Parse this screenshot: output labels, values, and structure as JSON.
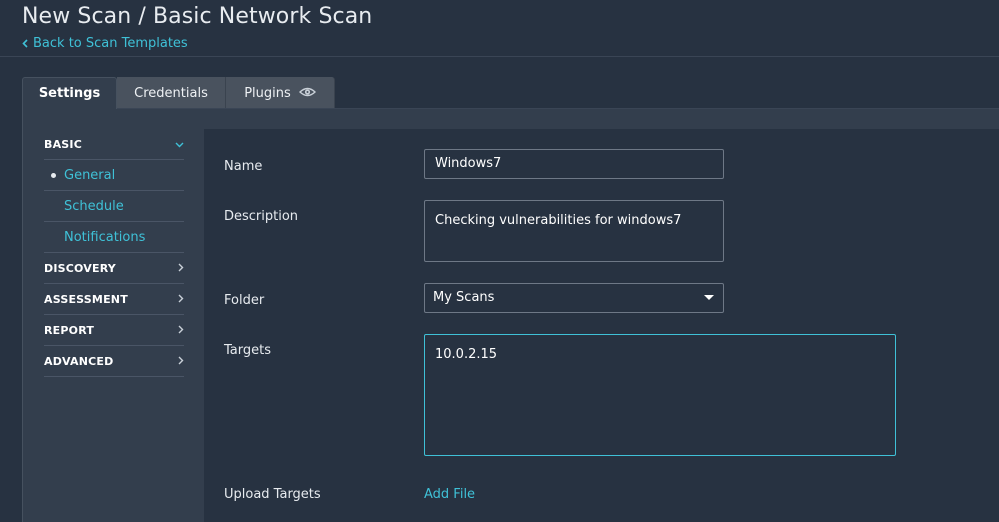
{
  "header": {
    "title": "New Scan / Basic Network Scan",
    "back_link": "Back to Scan Templates"
  },
  "tabs": [
    {
      "label": "Settings",
      "active": true
    },
    {
      "label": "Credentials",
      "active": false
    },
    {
      "label": "Plugins",
      "active": false,
      "icon": "eye-icon"
    }
  ],
  "sidebar": {
    "sections": [
      {
        "label": "BASIC",
        "expanded": true,
        "icon": "chevron-down-icon"
      },
      {
        "label": "DISCOVERY",
        "expanded": false,
        "icon": "chevron-right-icon"
      },
      {
        "label": "ASSESSMENT",
        "expanded": false,
        "icon": "chevron-right-icon"
      },
      {
        "label": "REPORT",
        "expanded": false,
        "icon": "chevron-right-icon"
      },
      {
        "label": "ADVANCED",
        "expanded": false,
        "icon": "chevron-right-icon"
      }
    ],
    "basic_items": [
      {
        "label": "General",
        "selected": true
      },
      {
        "label": "Schedule",
        "selected": false
      },
      {
        "label": "Notifications",
        "selected": false
      }
    ]
  },
  "form": {
    "name": {
      "label": "Name",
      "value": "Windows7"
    },
    "description": {
      "label": "Description",
      "value": "Checking vulnerabilities for windows7"
    },
    "folder": {
      "label": "Folder",
      "value": "My Scans"
    },
    "targets": {
      "label": "Targets",
      "value": "10.0.2.15"
    },
    "upload_targets": {
      "label": "Upload Targets",
      "action": "Add File"
    }
  },
  "colors": {
    "background": "#273241",
    "panel": "#333e4d",
    "accent": "#3fc1d7",
    "inactive_tab": "#49525e"
  }
}
